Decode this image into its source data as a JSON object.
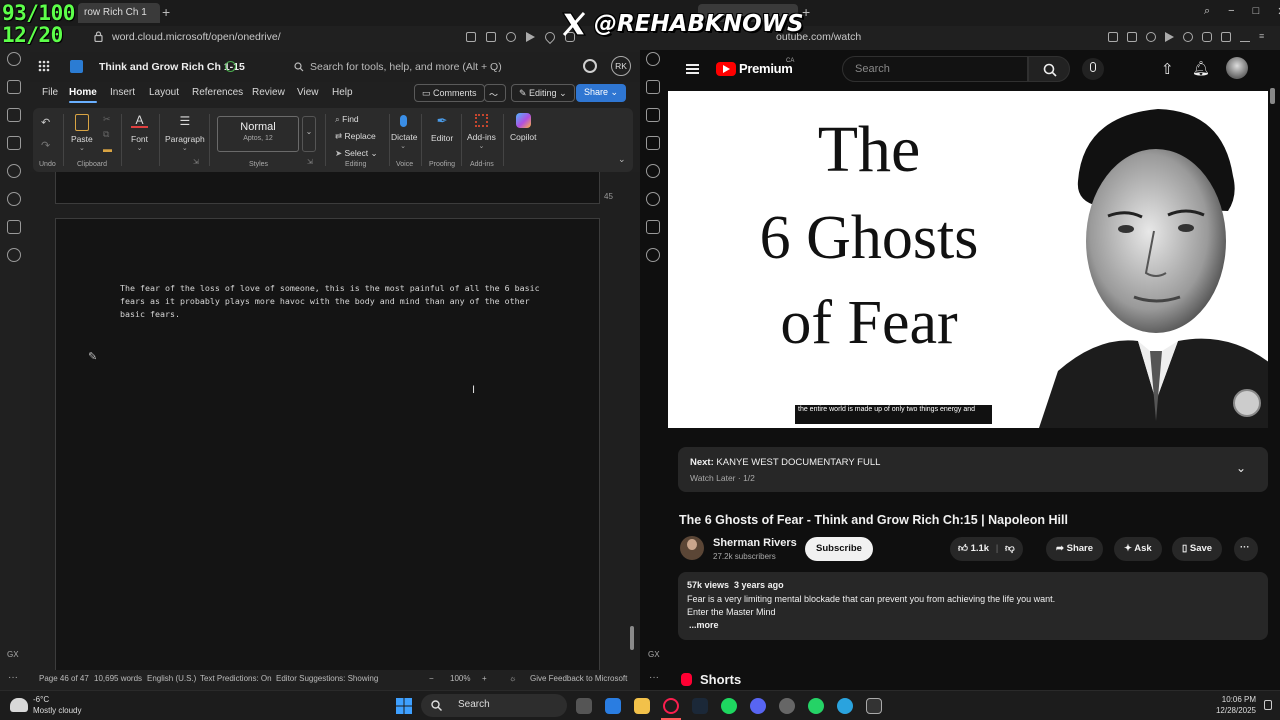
{
  "overlay": {
    "counter_top": "93/100",
    "counter_bottom": "12/20",
    "watermark": "@REHABKNOWS"
  },
  "colors": {
    "accent": "#2f76d2",
    "youtube_red": "#ff0000",
    "counter_green": "#5dff4a"
  },
  "left_browser": {
    "tab_title": "row Rich Ch 1",
    "url": "word.cloud.microsoft/open/onedrive/"
  },
  "word": {
    "doc_title": "Think and Grow Rich Ch 1-15",
    "search_placeholder": "Search for tools, help, and more (Alt + Q)",
    "avatar_initials": "RK",
    "menu": [
      "File",
      "Home",
      "Insert",
      "Layout",
      "References",
      "Review",
      "View",
      "Help"
    ],
    "comments_label": "Comments",
    "editing_label": "Editing",
    "share_label": "Share",
    "ribbon": {
      "undo_label": "Undo",
      "paste_label": "Paste",
      "clipboard_label": "Clipboard",
      "font_label": "Font",
      "paragraph_label": "Paragraph",
      "style_name": "Normal",
      "style_font": "Aptos, 12",
      "styles_label": "Styles",
      "find_label": "Find",
      "replace_label": "Replace",
      "select_label": "Select",
      "editing_group": "Editing",
      "dictate_label": "Dictate",
      "voice_label": "Voice",
      "editor_label": "Editor",
      "proofing_label": "Proofing",
      "addins_label": "Add-ins",
      "addins_group": "Add-ins",
      "copilot_label": "Copilot"
    },
    "prev_page_number": "45",
    "body_text": "The fear of the loss of love of someone, this is the most painful of all the 6 basic fears as it probably plays more havoc with the body and mind than any of the other basic fears.",
    "status": {
      "page": "Page 46 of 47",
      "words": "10,695 words",
      "language": "English (U.S.)",
      "predictions": "Text Predictions: On",
      "suggestions": "Editor Suggestions: Showing",
      "zoom": "100%",
      "feedback": "Give Feedback to Microsoft"
    }
  },
  "right_browser": {
    "url": "outube.com/watch"
  },
  "youtube": {
    "brand": "Premium",
    "region": "CA",
    "search_placeholder": "Search",
    "thumbnail_lines": [
      "The",
      "6 Ghosts",
      "of Fear"
    ],
    "caption": "the entire world is made up of only two things energy and",
    "next_label": "Next:",
    "next_title": "KANYE WEST DOCUMENTARY FULL",
    "next_sub": "Watch Later · 1/2",
    "video_title": "The 6 Ghosts of Fear - Think and Grow Rich Ch:15 | Napoleon Hill",
    "channel_name": "Sherman Rivers",
    "channel_subs": "27.2k subscribers",
    "subscribe_label": "Subscribe",
    "likes": "1.1k",
    "share_label": "Share",
    "ask_label": "Ask",
    "save_label": "Save",
    "views": "57k views  3 years ago",
    "desc_line1": "Fear is a very limiting mental blockade that can prevent you from achieving the life you want.",
    "desc_line2": "Enter the Master Mind",
    "more_label": "...more",
    "shorts_label": "Shorts"
  },
  "taskbar": {
    "temp": "-6°C",
    "weather": "Mostly cloudy",
    "search_label": "Search",
    "time": "10:06 PM",
    "date": "12/28/2025"
  },
  "side_label": "GX"
}
